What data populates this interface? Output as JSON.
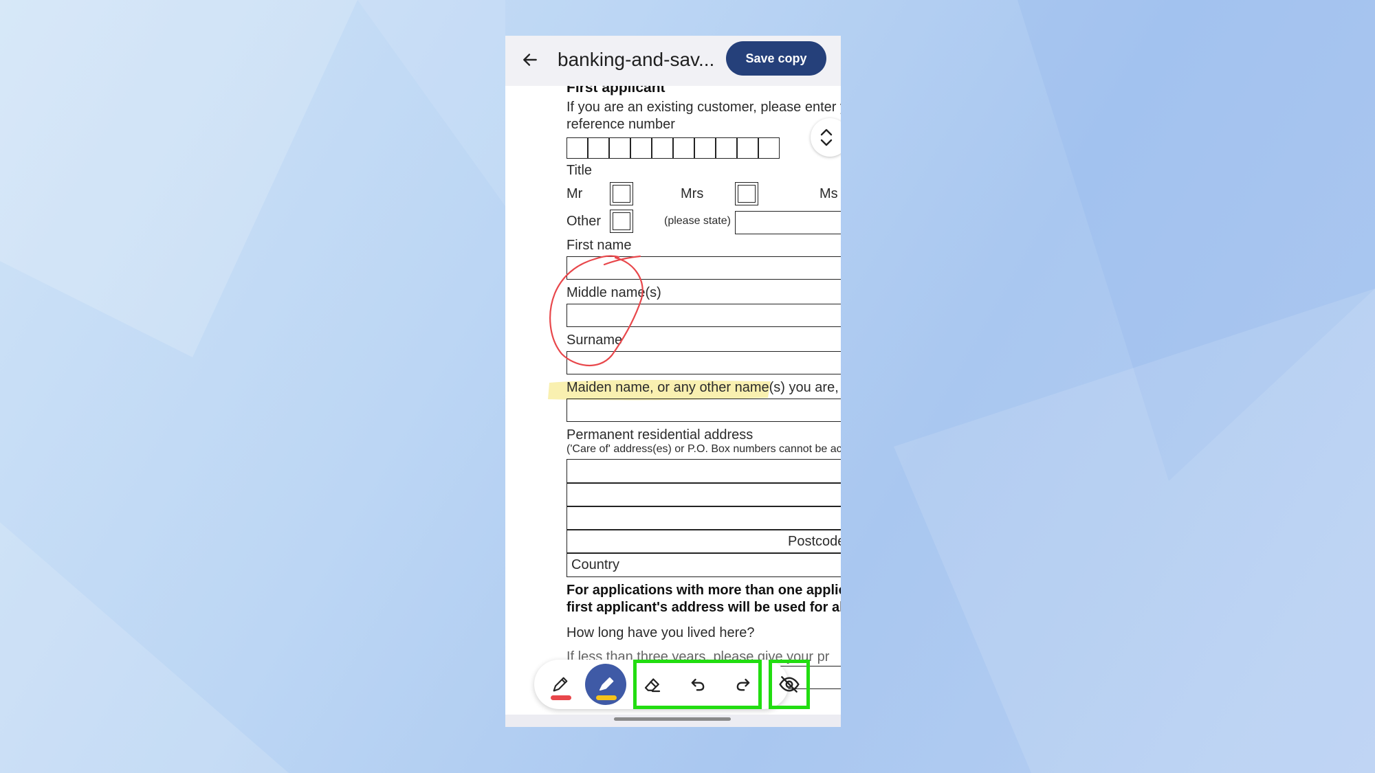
{
  "appbar": {
    "title": "banking-and-sav...",
    "save_label": "Save copy"
  },
  "form": {
    "section_heading": "First applicant",
    "existing_customer_line1": "If you are an existing customer, please enter y",
    "existing_customer_line2": "reference number",
    "title_label": "Title",
    "title_mr": "Mr",
    "title_mrs": "Mrs",
    "title_ms": "Ms",
    "title_other": "Other",
    "please_state": "(please state)",
    "first_name_label": "First name",
    "middle_name_label": "Middle name(s)",
    "surname_label": "Surname",
    "maiden_name_label": "Maiden name, or any other name(s) you are, o",
    "address_label": "Permanent residential address",
    "address_note": "('Care of' address(es) or P.O. Box numbers cannot be ac",
    "postcode_label": "Postcode",
    "country_label": "Country",
    "multi_applicant_line1": "For applications with more than one applica",
    "multi_applicant_line2": "first applicant's address will be used for all",
    "how_long_label": "How long have you lived here?",
    "partial_line": "If less than three years, please give your pr"
  },
  "toolbar": {
    "tools": [
      {
        "name": "pen",
        "icon": "pen-icon",
        "swatch": "#e8474b",
        "active": false
      },
      {
        "name": "highlighter",
        "icon": "highlighter-icon",
        "swatch": "#f6c31b",
        "active": true
      },
      {
        "name": "eraser",
        "icon": "eraser-icon"
      },
      {
        "name": "undo",
        "icon": "undo-icon"
      },
      {
        "name": "redo",
        "icon": "redo-icon"
      },
      {
        "name": "hide-annotations",
        "icon": "eye-off-icon"
      }
    ]
  },
  "colors": {
    "accent": "#25407a",
    "active_tool": "#3f5aa6",
    "highlight_box": "#22dd11",
    "annotation_red": "#e8474b",
    "annotation_yellow": "#f8ec9c"
  }
}
